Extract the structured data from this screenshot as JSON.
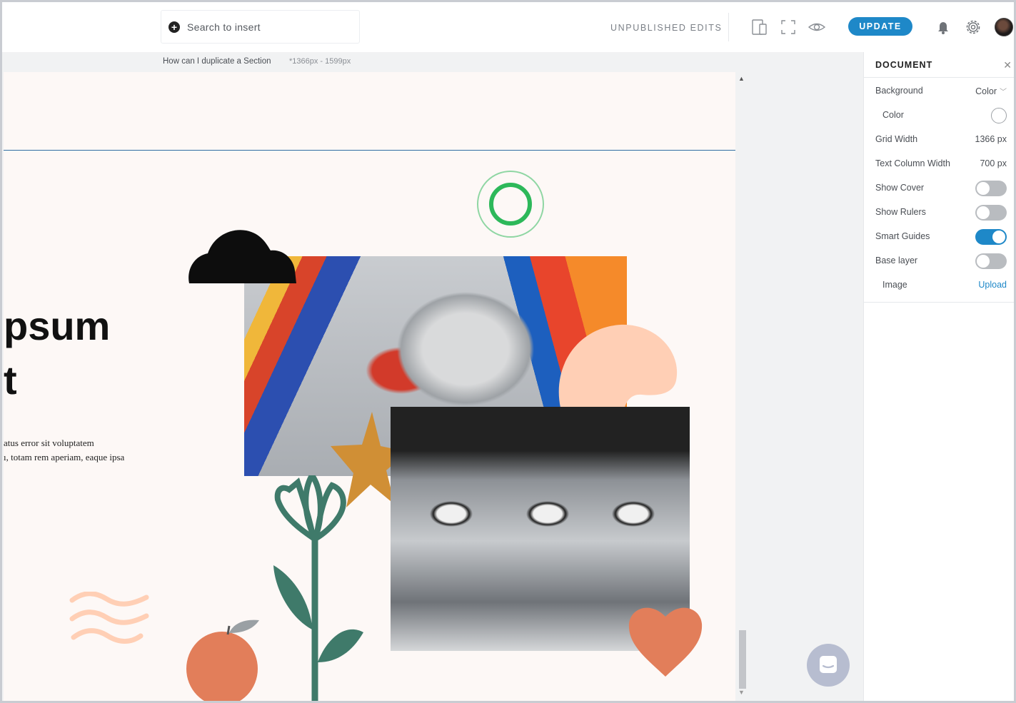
{
  "topbar": {
    "search_placeholder": "Search to insert",
    "status": "UNPUBLISHED EDITS",
    "update_label": "UPDATE",
    "icons": [
      "device-preview-icon",
      "fullscreen-icon",
      "eye-icon",
      "bell-icon",
      "gear-icon"
    ]
  },
  "breadcrumb": {
    "title": "How can I duplicate a Section",
    "size": "*1366px - 1599px"
  },
  "canvas": {
    "hero_title_line1": "psum",
    "hero_title_line2": "t",
    "body_line1": "atus error sit voluptatem",
    "body_line2": "ı, totam rem aperiam, eaque ipsa"
  },
  "panel": {
    "title": "DOCUMENT",
    "background_label": "Background",
    "background_value": "Color",
    "color_label": "Color",
    "grid_width_label": "Grid Width",
    "grid_width_value": "1366 px",
    "text_col_label": "Text Column Width",
    "text_col_value": "700 px",
    "show_cover_label": "Show Cover",
    "show_cover_on": false,
    "show_rulers_label": "Show Rulers",
    "show_rulers_on": false,
    "smart_guides_label": "Smart Guides",
    "smart_guides_on": true,
    "base_layer_label": "Base layer",
    "base_layer_on": false,
    "image_label": "Image",
    "upload_label": "Upload"
  },
  "colors": {
    "accent": "#1e88c8",
    "canvas_bg": "#fdf8f6",
    "peach": "#ffcfb5",
    "coral": "#e27e5a",
    "mustard": "#d08f35",
    "teal": "#3f7a6a",
    "green_ring": "#2db85a"
  }
}
